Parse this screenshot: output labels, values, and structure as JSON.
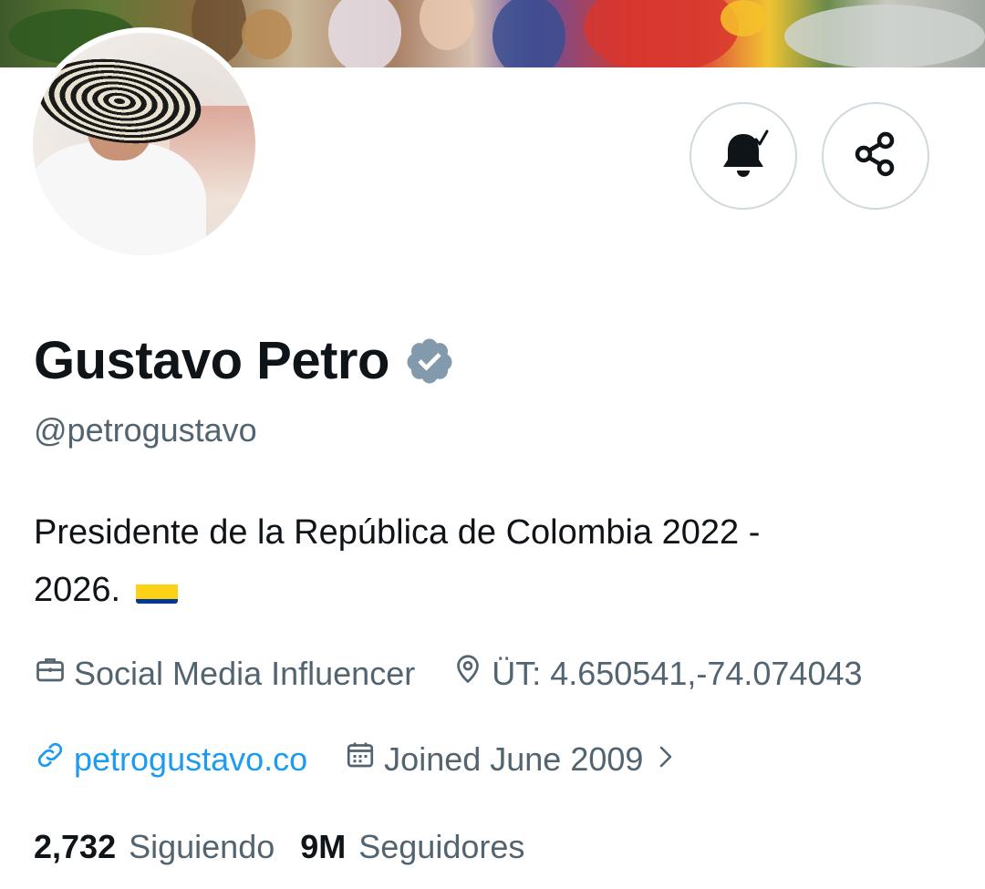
{
  "profile": {
    "name": "Gustavo Petro",
    "handle": "@petrogustavo",
    "bio_line1": "Presidente de la República de Colombia 2022 -",
    "bio_line2": "2026.",
    "bio_flag": "colombia-flag-emoji",
    "verified_icon": "verified-badge-icon"
  },
  "meta": {
    "category": "Social Media Influencer",
    "location": "ÜT: 4.650541,-74.074043",
    "website": "petrogustavo.co",
    "joined": "Joined June 2009"
  },
  "stats": {
    "following_count": "2,732",
    "following_label": "Siguiendo",
    "followers_count": "9M",
    "followers_label": "Seguidores"
  },
  "actions": {
    "notify_icon": "bell-check-icon",
    "share_icon": "share-icon"
  },
  "colors": {
    "text_primary": "#0f1419",
    "text_secondary": "#536471",
    "link": "#1d9bf0",
    "border": "#cfd9de",
    "verified": "#829aab"
  }
}
